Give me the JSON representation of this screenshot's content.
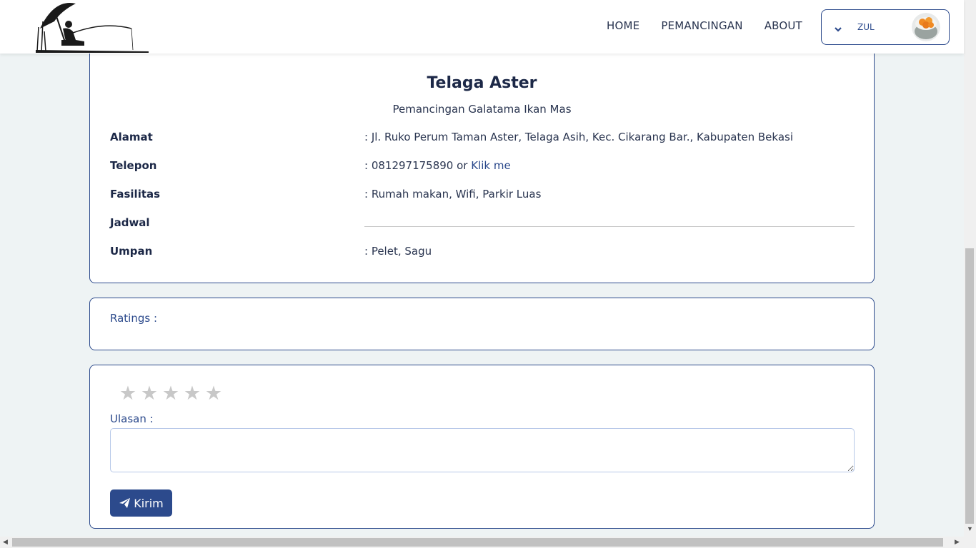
{
  "navbar": {
    "links": [
      "HOME",
      "PEMANCINGAN",
      "ABOUT"
    ],
    "user": {
      "name": "ZUL",
      "avatar_icon": "sushi-avatar"
    }
  },
  "detail": {
    "title": "Telaga Aster",
    "subtitle": "Pemancingan Galatama Ikan Mas",
    "rows": [
      {
        "label": "Alamat",
        "value": ": Jl. Ruko Perum Taman Aster, Telaga Asih, Kec. Cikarang Bar., Kabupaten Bekasi"
      },
      {
        "label": "Telepon",
        "value": ": 081297175890 or ",
        "link": "Klik me"
      },
      {
        "label": "Fasilitas",
        "value": ": Rumah makan, Wifi, Parkir Luas"
      },
      {
        "label": "Jadwal",
        "value": ""
      },
      {
        "label": "Umpan",
        "value": ": Pelet, Sagu"
      }
    ]
  },
  "ratings": {
    "label": "Ratings :"
  },
  "review": {
    "stars_selected": 0,
    "stars_total": 5,
    "ulasan_label": "Ulasan :",
    "ulasan_value": "",
    "submit_label": "Kirim"
  },
  "colors": {
    "accent": "#2c4a8c",
    "background": "#eef3f4",
    "star_inactive": "#c8c8c8"
  }
}
